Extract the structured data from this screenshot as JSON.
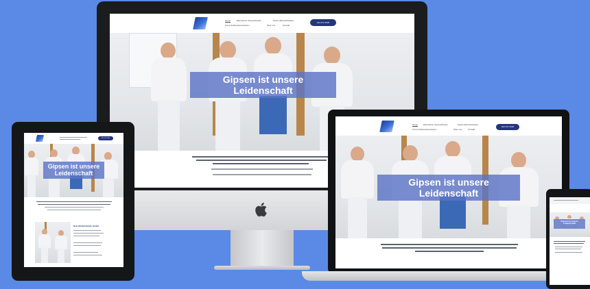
{
  "site": {
    "hero_caption_line1": "Gipsen ist unsere",
    "hero_caption_line2": "Leidenschaft",
    "nav": {
      "home": "Home",
      "item2": "Ebersteiner Gipserarbeiten",
      "item3": "Gipser Ebersteinkeiten",
      "item4": "Kunst & Ebersteinenheiten",
      "item5": "Über uns",
      "item6": "Kontakt",
      "cta": "024 971 5535"
    },
    "tablet_heading": "Dein Modell Bundy GmbH"
  },
  "colors": {
    "background": "#5b89e6",
    "accent": "#25347d",
    "caption_overlay": "#5c74c4"
  },
  "icons": {
    "apple_logo": "apple-icon"
  }
}
